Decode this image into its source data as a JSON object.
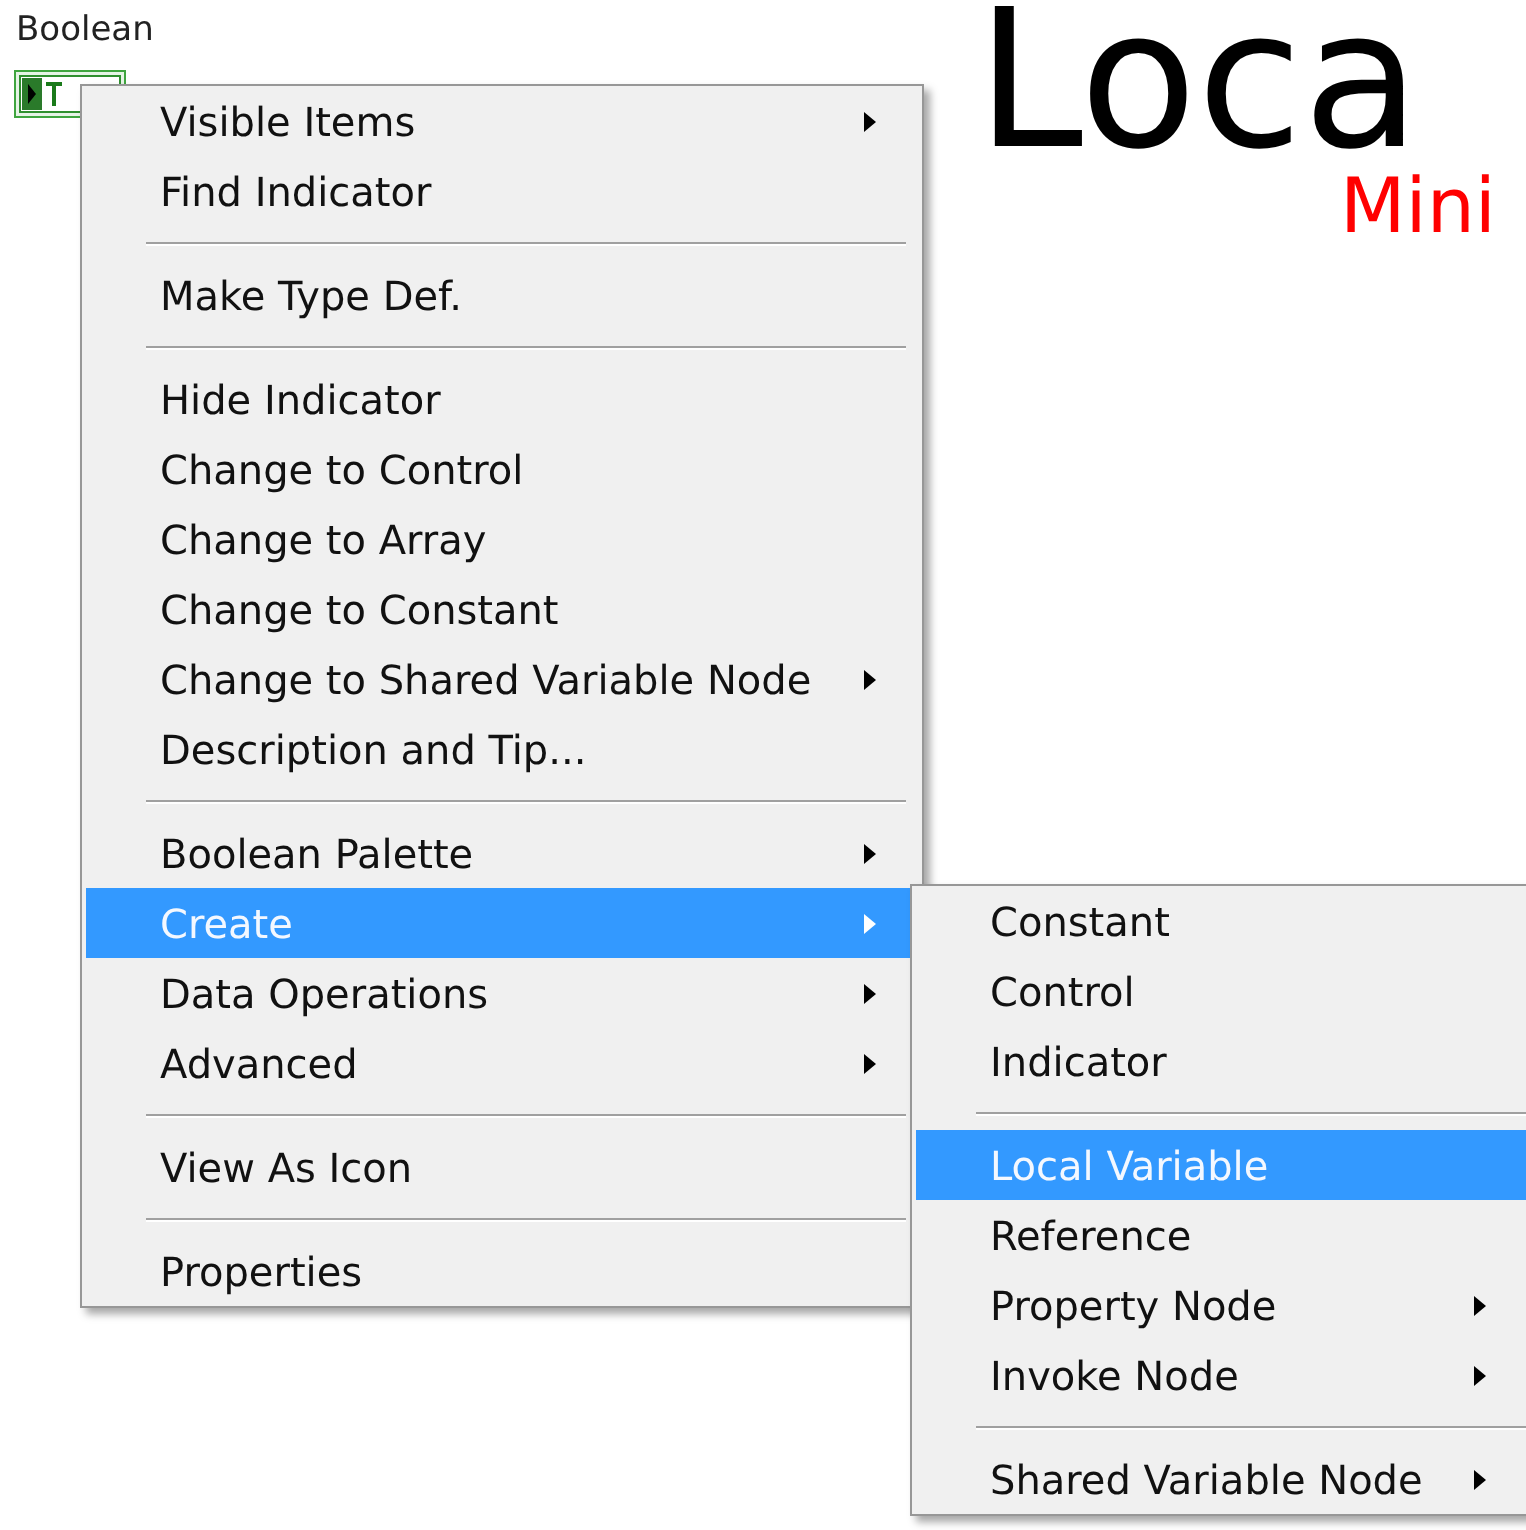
{
  "slide": {
    "title": "Loca",
    "subtitle": "Mini"
  },
  "front_panel": {
    "label": "Boolean"
  },
  "context_menu": {
    "sections": [
      [
        {
          "label": "Visible Items",
          "submenu": true,
          "selected": false
        },
        {
          "label": "Find Indicator",
          "submenu": false,
          "selected": false
        }
      ],
      [
        {
          "label": "Make Type Def.",
          "submenu": false,
          "selected": false
        }
      ],
      [
        {
          "label": "Hide Indicator",
          "submenu": false,
          "selected": false
        },
        {
          "label": "Change to Control",
          "submenu": false,
          "selected": false
        },
        {
          "label": "Change to Array",
          "submenu": false,
          "selected": false
        },
        {
          "label": "Change to Constant",
          "submenu": false,
          "selected": false
        },
        {
          "label": "Change to Shared Variable Node",
          "submenu": true,
          "selected": false
        },
        {
          "label": "Description and Tip...",
          "submenu": false,
          "selected": false
        }
      ],
      [
        {
          "label": "Boolean Palette",
          "submenu": true,
          "selected": false
        },
        {
          "label": "Create",
          "submenu": true,
          "selected": true
        },
        {
          "label": "Data Operations",
          "submenu": true,
          "selected": false
        },
        {
          "label": "Advanced",
          "submenu": true,
          "selected": false
        }
      ],
      [
        {
          "label": "View As Icon",
          "submenu": false,
          "selected": false
        }
      ],
      [
        {
          "label": "Properties",
          "submenu": false,
          "selected": false
        }
      ]
    ]
  },
  "submenu": {
    "sections": [
      [
        {
          "label": "Constant",
          "submenu": false,
          "selected": false
        },
        {
          "label": "Control",
          "submenu": false,
          "selected": false
        },
        {
          "label": "Indicator",
          "submenu": false,
          "selected": false
        }
      ],
      [
        {
          "label": "Local Variable",
          "submenu": false,
          "selected": true
        },
        {
          "label": "Reference",
          "submenu": false,
          "selected": false
        },
        {
          "label": "Property Node",
          "submenu": true,
          "selected": false
        },
        {
          "label": "Invoke Node",
          "submenu": true,
          "selected": false
        }
      ],
      [
        {
          "label": "Shared Variable Node",
          "submenu": true,
          "selected": false
        }
      ]
    ]
  }
}
